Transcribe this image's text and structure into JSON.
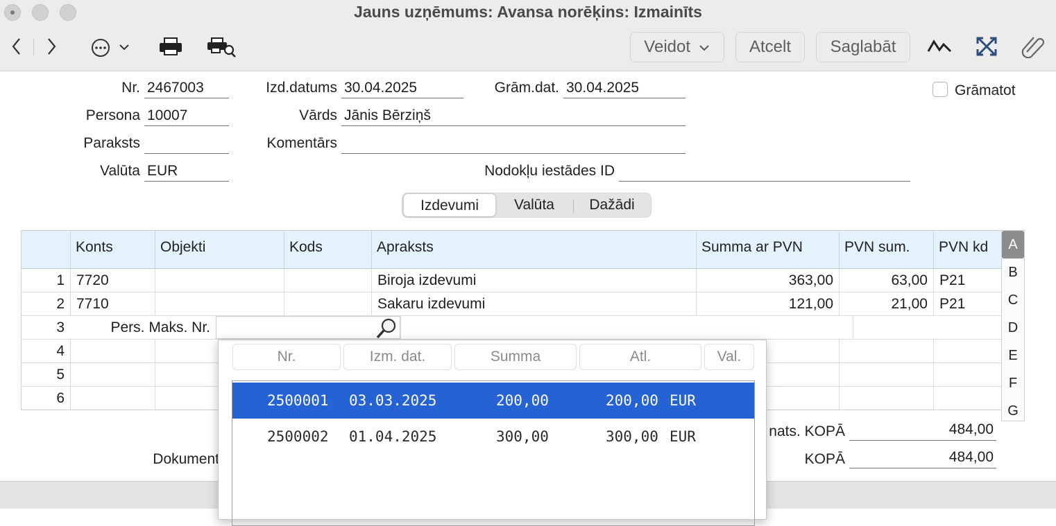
{
  "window": {
    "title": "Jauns uzņēmums: Avansa norēķins: Izmainīts"
  },
  "toolbar": {
    "back_icon": "chevron-left-icon",
    "forward_icon": "chevron-right-icon",
    "more_icon": "ellipsis-circle-icon",
    "print_icon": "printer-icon",
    "print_preview_icon": "print-preview-icon",
    "create_label": "Veidot",
    "cancel_label": "Atcelt",
    "save_label": "Saglabāt",
    "activity_icon": "pulse-icon",
    "fullscreen_icon": "expand-icon",
    "attach_icon": "paperclip-icon"
  },
  "header": {
    "nr_label": "Nr.",
    "nr_value": "2467003",
    "izd_label": "Izd.datums",
    "izd_value": "30.04.2025",
    "gram_label": "Grām.dat.",
    "gram_value": "30.04.2025",
    "gramatot_label": "Grāmatot",
    "persona_label": "Persona",
    "persona_value": "10007",
    "vards_label": "Vārds",
    "vards_value": "Jānis Bērziņš",
    "paraksts_label": "Paraksts",
    "paraksts_value": "",
    "komentars_label": "Komentārs",
    "komentars_value": "",
    "valuta_label": "Valūta",
    "valuta_value": "EUR",
    "nodoklu_label": "Nodokļu iestādes ID",
    "nodoklu_value": ""
  },
  "tabs": [
    "Izdevumi",
    "Valūta",
    "Dažādi"
  ],
  "table": {
    "columns": [
      "Konts",
      "Objekti",
      "Kods",
      "Apraksts",
      "Summa ar PVN",
      "PVN sum.",
      "PVN kd"
    ],
    "rows": [
      {
        "n": "1",
        "konts": "7720",
        "apraksts": "Biroja izdevumi",
        "summa": "363,00",
        "pvn": "63,00",
        "kd": "P21"
      },
      {
        "n": "2",
        "konts": "7710",
        "apraksts": "Sakaru izdevumi",
        "summa": "121,00",
        "pvn": "21,00",
        "kd": "P21"
      }
    ],
    "row3_num": "3",
    "row3_label": "Pers. Maks. Nr.",
    "empty_rows": [
      "4",
      "5",
      "6"
    ]
  },
  "side_letters": [
    "A",
    "B",
    "C",
    "D",
    "E",
    "F",
    "G"
  ],
  "totals": {
    "partial_label1": "nats. KOPĀ",
    "value1": "484,00",
    "partial_label_left": "Dokument",
    "label2": "KOPĀ",
    "value2": "484,00"
  },
  "popup": {
    "headers": [
      "Nr.",
      "Izm. dat.",
      "Summa",
      "Atl.",
      "Val."
    ],
    "rows": [
      {
        "nr": "2500001",
        "date": "03.03.2025",
        "summa": "200,00",
        "atl": "200,00",
        "val": "EUR"
      },
      {
        "nr": "2500002",
        "date": "01.04.2025",
        "summa": "300,00",
        "atl": "300,00",
        "val": "EUR"
      }
    ]
  },
  "colors": {
    "selection": "#2563d4",
    "table_header": "#e4f2fb"
  }
}
